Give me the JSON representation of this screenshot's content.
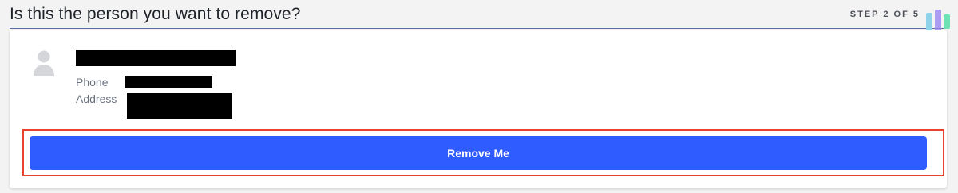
{
  "header": {
    "title": "Is this the person you want to remove?",
    "step": "STEP 2 OF 5"
  },
  "record": {
    "phone_label": "Phone",
    "address_label": "Address"
  },
  "actions": {
    "remove_label": "Remove Me"
  },
  "colors": {
    "button": "#2f5cff",
    "highlight": "#e8412c",
    "underline": "#5a6fa6"
  },
  "icons": [
    "user-avatar-icon"
  ]
}
